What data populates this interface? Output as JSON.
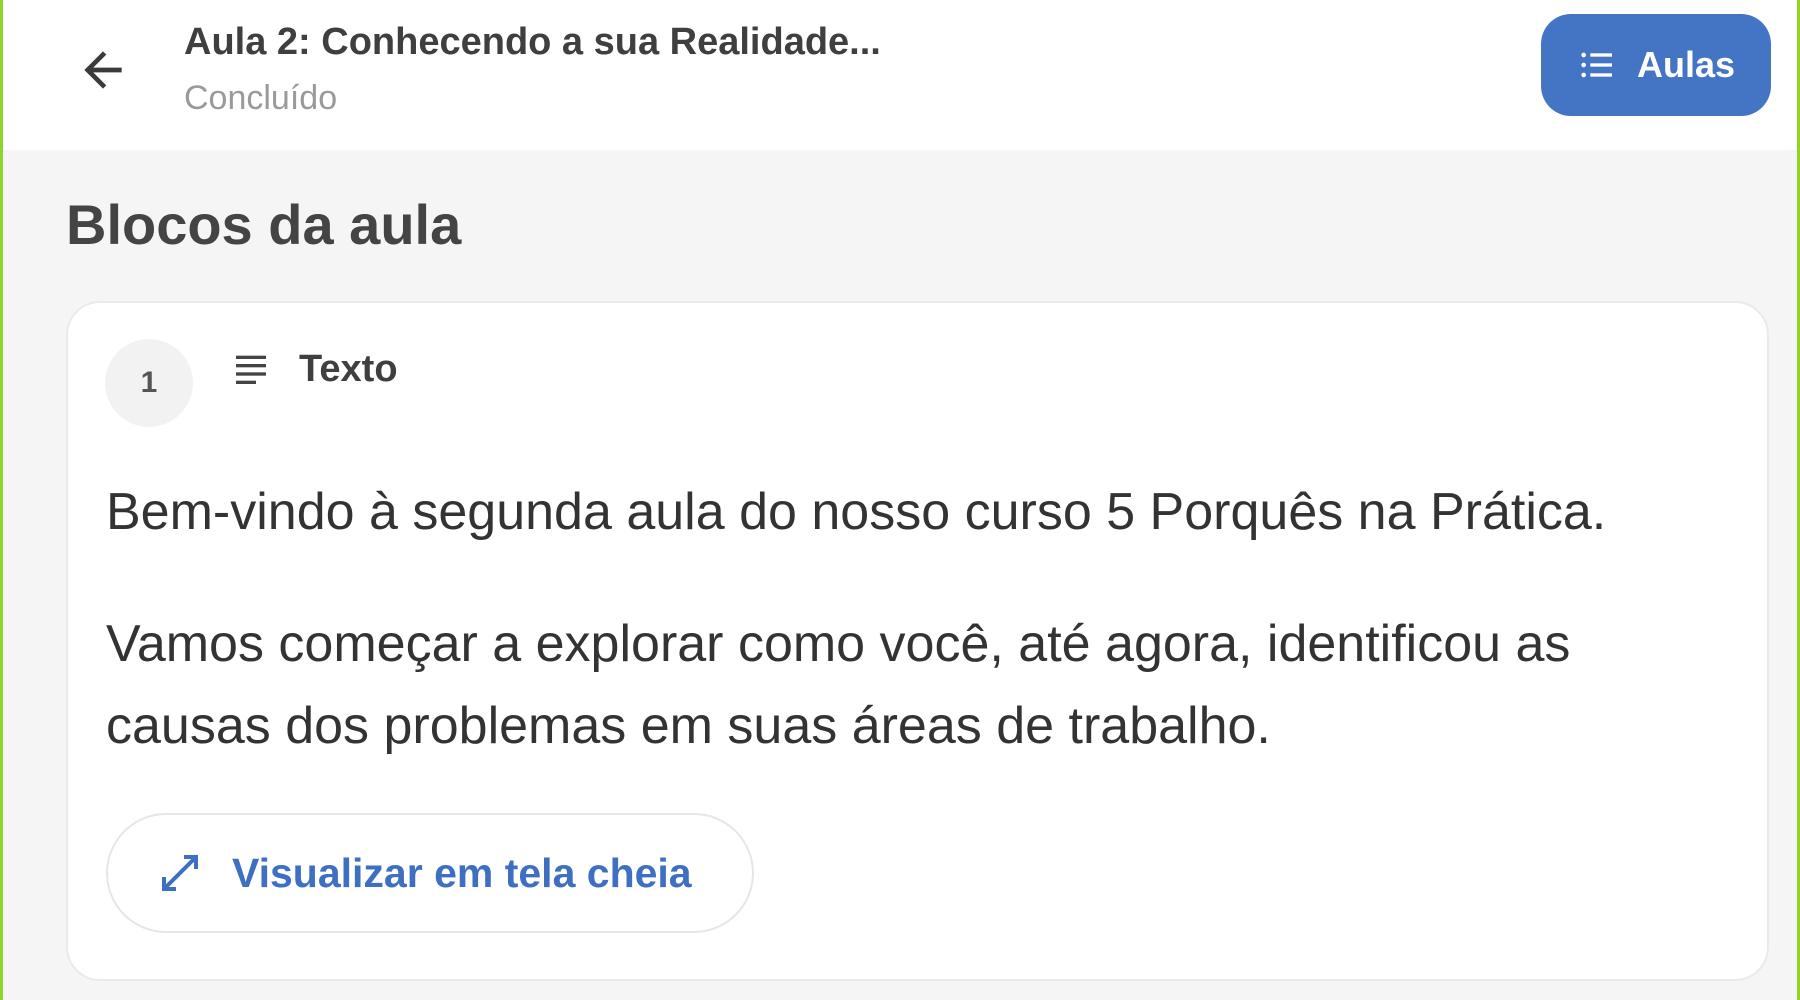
{
  "header": {
    "back_icon": "arrow-left-icon",
    "title": "Aula 2: Conhecendo a sua Realidade...",
    "status": "Concluído",
    "aulas_button": {
      "icon": "list-icon",
      "label": "Aulas"
    }
  },
  "main": {
    "section_title": "Blocos da aula",
    "blocks": [
      {
        "number": "1",
        "type_icon": "text-lines-icon",
        "type_label": "Texto",
        "paragraphs": [
          "Bem-vindo à segunda aula do nosso curso 5 Porquês na Prática.",
          "Vamos começar a explorar como você, até agora, identificou as causas dos problemas em suas áreas de trabalho."
        ],
        "fullscreen_button": {
          "icon": "expand-diagonal-icon",
          "label": "Visualizar em tela cheia"
        }
      }
    ]
  },
  "colors": {
    "accent": "#4474c4",
    "link": "#3f6fc0",
    "frame_border": "#8fd42a",
    "background": "#f5f5f5"
  }
}
